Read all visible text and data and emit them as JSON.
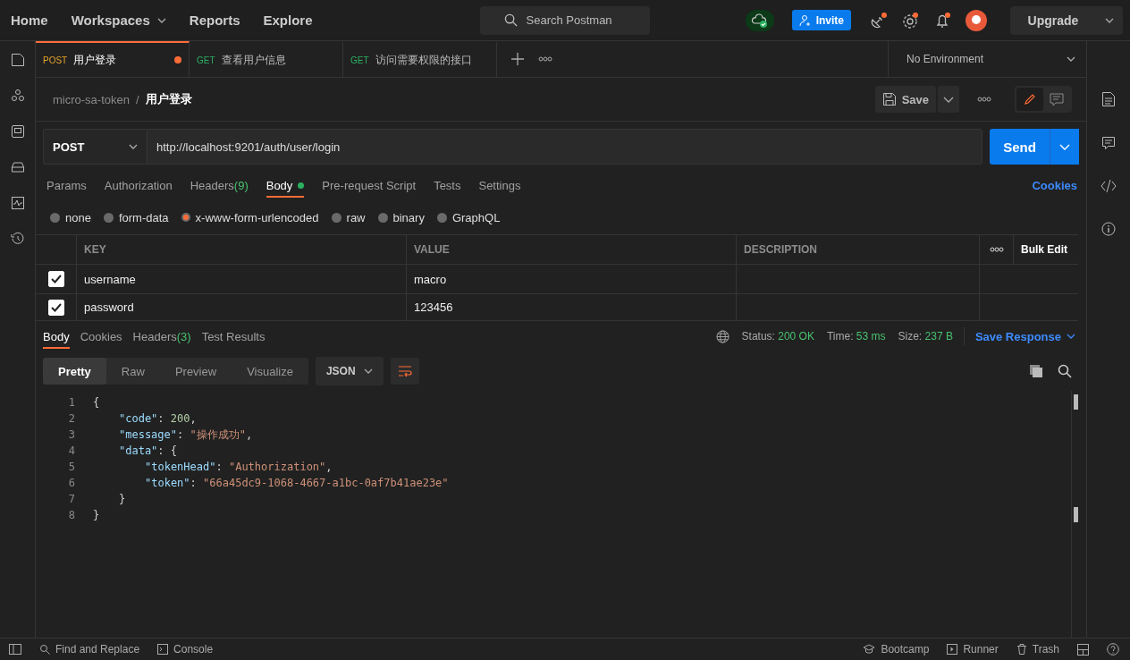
{
  "top_nav": [
    {
      "label": "Home",
      "menu": false
    },
    {
      "label": "Workspaces",
      "menu": true
    },
    {
      "label": "Reports",
      "menu": false
    },
    {
      "label": "Explore",
      "menu": false
    }
  ],
  "search": {
    "placeholder": "Search Postman"
  },
  "invite": "Invite",
  "upgrade": "Upgrade",
  "tabs": [
    {
      "method": "POST",
      "name": "用户登录",
      "selected": true,
      "unsaved": true
    },
    {
      "method": "GET",
      "name": "查看用户信息",
      "selected": false,
      "unsaved": false
    },
    {
      "method": "GET",
      "name": "访问需要权限的接口",
      "selected": false,
      "unsaved": false
    }
  ],
  "environment": "No Environment",
  "breadcrumb": {
    "collection": "micro-sa-token",
    "separator": "/",
    "request": "用户登录"
  },
  "save": "Save",
  "editor_modes": [
    {
      "selected": true
    },
    {
      "selected": false
    }
  ],
  "request": {
    "method": "POST",
    "url": "http://localhost:9201/auth/user/login",
    "send": "Send"
  },
  "request_tabs": [
    {
      "label": "Params",
      "selected": false,
      "has_content": false
    },
    {
      "label": "Authorization",
      "selected": false,
      "has_content": false
    },
    {
      "label": "Headers",
      "count": "(9)",
      "selected": false,
      "has_content": false
    },
    {
      "label": "Body",
      "selected": true,
      "has_content": true
    },
    {
      "label": "Pre-request Script",
      "selected": false,
      "has_content": false
    },
    {
      "label": "Tests",
      "selected": false,
      "has_content": false
    },
    {
      "label": "Settings",
      "selected": false,
      "has_content": false
    }
  ],
  "cookies": "Cookies",
  "body_types": [
    {
      "label": "none",
      "selected": false
    },
    {
      "label": "form-data",
      "selected": false
    },
    {
      "label": "x-www-form-urlencoded",
      "selected": true
    },
    {
      "label": "raw",
      "selected": false
    },
    {
      "label": "binary",
      "selected": false
    },
    {
      "label": "GraphQL",
      "selected": false
    }
  ],
  "params_table": {
    "columns": [
      "KEY",
      "VALUE",
      "DESCRIPTION"
    ],
    "bulk_edit": "Bulk Edit",
    "rows": [
      {
        "checked": true,
        "key": "username",
        "value": "macro"
      },
      {
        "checked": true,
        "key": "password",
        "value": "123456"
      }
    ]
  },
  "response": {
    "tabs": [
      {
        "label": "Body",
        "selected": true
      },
      {
        "label": "Cookies",
        "selected": false
      },
      {
        "label": "Headers",
        "count": "(3)",
        "selected": false
      },
      {
        "label": "Test Results",
        "selected": false
      }
    ],
    "metrics": [
      {
        "label": "Status:",
        "value": "200 OK"
      },
      {
        "label": "Time:",
        "value": "53 ms"
      },
      {
        "label": "Size:",
        "value": "237 B"
      }
    ],
    "save_response": "Save Response",
    "view_modes": [
      {
        "label": "Pretty",
        "selected": true
      },
      {
        "label": "Raw",
        "selected": false
      },
      {
        "label": "Preview",
        "selected": false
      },
      {
        "label": "Visualize",
        "selected": false
      }
    ],
    "format": "JSON",
    "code": [
      {
        "number": "1",
        "tokens": [
          {
            "kind": "punct",
            "text": "{"
          }
        ],
        "children": [
          {
            "number": "2",
            "tokens": [
              {
                "kind": "key",
                "text": "\"code\""
              },
              {
                "kind": "punct",
                "text": ": "
              },
              {
                "kind": "number",
                "text": "200"
              },
              {
                "kind": "punct",
                "text": ","
              }
            ]
          },
          {
            "number": "3",
            "tokens": [
              {
                "kind": "key",
                "text": "\"message\""
              },
              {
                "kind": "punct",
                "text": ": "
              },
              {
                "kind": "string",
                "text": "\"操作成功\""
              },
              {
                "kind": "punct",
                "text": ","
              }
            ]
          },
          {
            "number": "4",
            "tokens": [
              {
                "kind": "key",
                "text": "\"data\""
              },
              {
                "kind": "punct",
                "text": ": {"
              }
            ],
            "children": [
              {
                "number": "5",
                "tokens": [
                  {
                    "kind": "key",
                    "text": "\"tokenHead\""
                  },
                  {
                    "kind": "punct",
                    "text": ": "
                  },
                  {
                    "kind": "string",
                    "text": "\"Authorization\""
                  },
                  {
                    "kind": "punct",
                    "text": ","
                  }
                ]
              },
              {
                "number": "6",
                "tokens": [
                  {
                    "kind": "key",
                    "text": "\"token\""
                  },
                  {
                    "kind": "punct",
                    "text": ": "
                  },
                  {
                    "kind": "string",
                    "text": "\"66a45dc9-1068-4667-a1bc-0af7b41ae23e\""
                  }
                ]
              }
            ]
          },
          {
            "number": "7",
            "tokens": [
              {
                "kind": "punct",
                "text": "}"
              }
            ]
          }
        ]
      },
      {
        "number": "8",
        "tokens": [
          {
            "kind": "punct",
            "text": "}"
          }
        ]
      }
    ]
  },
  "status_bar": {
    "find": "Find and Replace",
    "console": "Console",
    "bootcamp": "Bootcamp",
    "runner": "Runner",
    "trash": "Trash"
  }
}
